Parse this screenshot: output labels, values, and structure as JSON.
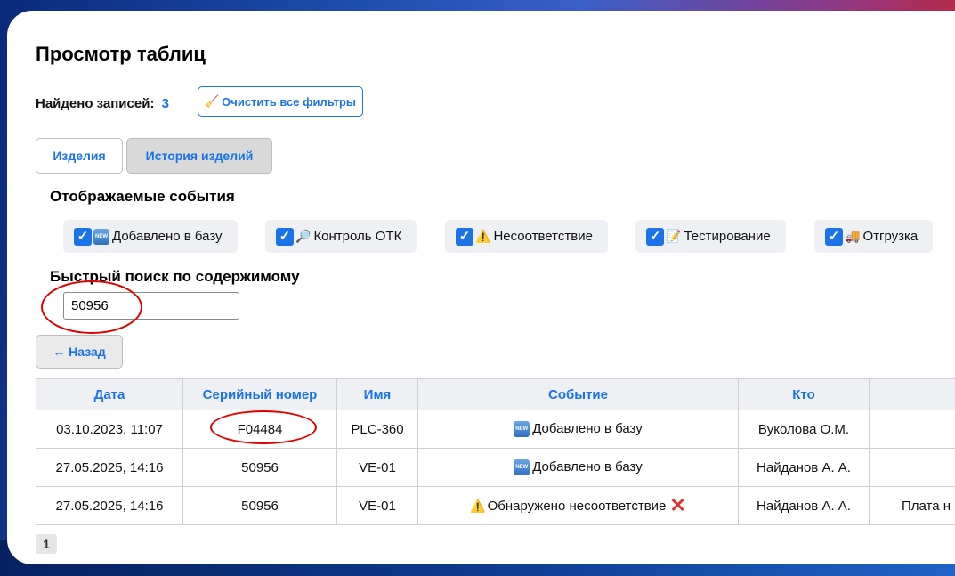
{
  "page": {
    "title": "Просмотр таблиц"
  },
  "summary": {
    "found_label": "Найдено записей:",
    "found_count": "3"
  },
  "toolbar": {
    "clear_filters_label": "Очистить все фильтры",
    "clear_filters_icon": "broom-icon"
  },
  "tabs": [
    {
      "label": "Изделия",
      "active": true
    },
    {
      "label": "История изделий",
      "active": false
    }
  ],
  "events_filter": {
    "title": "Отображаемые события",
    "items": [
      {
        "label": "Добавлено в базу",
        "icon": "new-badge-icon",
        "checked": true
      },
      {
        "label": "Контроль ОТК",
        "icon": "magnifier-icon",
        "checked": true
      },
      {
        "label": "Несоответствие",
        "icon": "warning-icon",
        "checked": true
      },
      {
        "label": "Тестирование",
        "icon": "memo-icon",
        "checked": true
      },
      {
        "label": "Отгрузка",
        "icon": "truck-icon",
        "checked": true
      }
    ]
  },
  "search": {
    "title": "Быстрый поиск по содержимому",
    "value": "50956"
  },
  "back_button": {
    "label": "← Назад"
  },
  "table": {
    "columns": [
      "Дата",
      "Серийный номер",
      "Имя",
      "Событие",
      "Кто",
      ""
    ],
    "rows": [
      {
        "date": "03.10.2023, 11:07",
        "serial": "F04484",
        "name": "PLC-360",
        "event": "Добавлено в базу",
        "event_icon": "new-badge-icon",
        "who": "Вуколова О.М.",
        "extra": ""
      },
      {
        "date": "27.05.2025, 14:16",
        "serial": "50956",
        "name": "VE-01",
        "event": "Добавлено в базу",
        "event_icon": "new-badge-icon",
        "who": "Найданов А. А.",
        "extra": ""
      },
      {
        "date": "27.05.2025, 14:16",
        "serial": "50956",
        "name": "VE-01",
        "event": "Обнаружено несоответствие",
        "event_icon": "warning-icon",
        "event_suffix_icon": "cross-mark-icon",
        "who": "Найданов А. А.",
        "extra": "Плата н"
      }
    ]
  },
  "pagination": {
    "current": "1"
  },
  "colors": {
    "accent": "#1a73e8",
    "annotation": "#e00000",
    "checkbox": "#1a73e8"
  }
}
